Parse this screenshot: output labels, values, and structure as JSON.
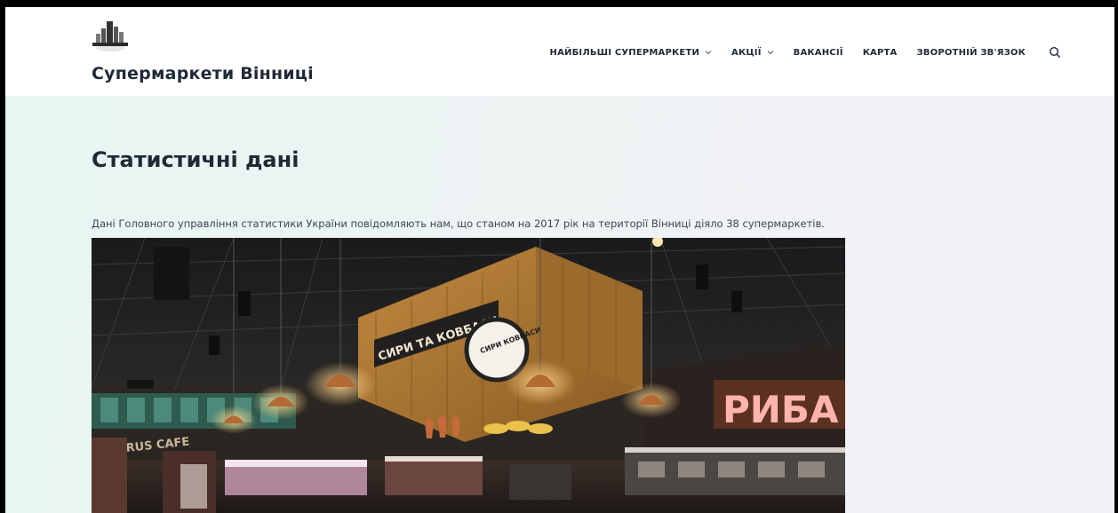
{
  "header": {
    "site_title": "Супермаркети Вінниці",
    "logo_icon": "city-skyline-icon"
  },
  "nav": {
    "items": [
      {
        "label": "НАЙБІЛЬШІ СУПЕРМАРКЕТИ",
        "has_dropdown": true
      },
      {
        "label": "АКЦІЇ",
        "has_dropdown": true
      },
      {
        "label": "ВАКАНСІЇ",
        "has_dropdown": false
      },
      {
        "label": "КАРТА",
        "has_dropdown": false
      },
      {
        "label": "ЗВОРОТНІЙ ЗВ'ЯЗОК",
        "has_dropdown": false
      }
    ],
    "search_icon": "search-icon"
  },
  "main": {
    "title": "Статистичні дані",
    "intro": "Дані Головного управління статистики України повідомляють нам, що станом на 2017 рік на території Вінниці діяло 38 супермаркетів.",
    "photo": {
      "sign_riba": "РИБА",
      "sign_cheese": "СИРИ ТА КОВБАСИ",
      "sign_round": "СИРИ КОВБАСИ",
      "sign_cafe": "VARUS CAFE"
    }
  }
}
